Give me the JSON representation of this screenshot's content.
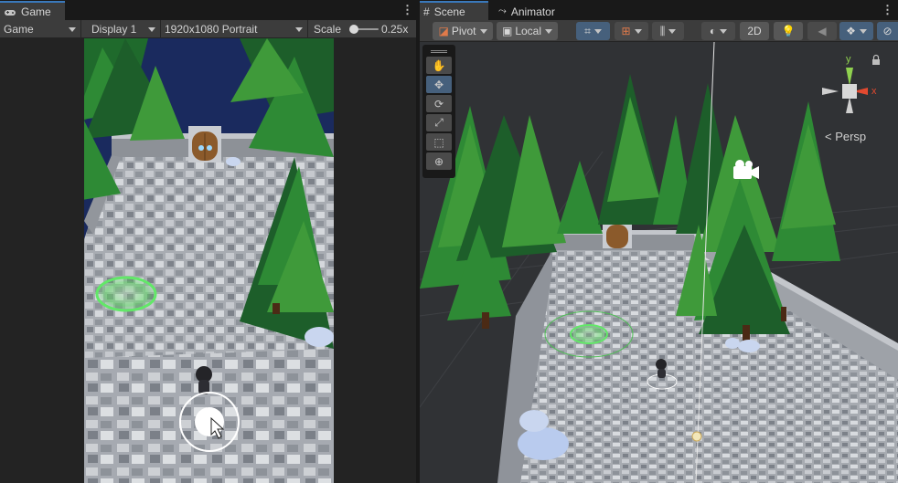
{
  "colors": {
    "accent_blue": "#3a79bb",
    "panel_bg": "#282828",
    "toolbar_bg": "#3c3c3c",
    "tab_bg": "#191919",
    "gizmo_y": "#8fd14f",
    "gizmo_x": "#e2492f",
    "tree_dark": "#1d5e2a",
    "tree_light": "#3f9a3a",
    "stone_floor": "#a9adb3",
    "night_sky": "#1a2a5e"
  },
  "game": {
    "tab_label": "Game",
    "tab_icon": "gamepad-icon",
    "mode_dropdown": "Game",
    "display_dropdown": "Display 1",
    "resolution_dropdown": "1920x1080 Portrait",
    "scale_label": "Scale",
    "scale_value": "0.25x",
    "scale_fraction": 0.25
  },
  "scene": {
    "tab_label": "Scene",
    "tab_icon": "grid-icon",
    "animator_tab_label": "Animator",
    "animator_icon": "animator-icon",
    "pivot_label": "Pivot",
    "local_label": "Local",
    "mode_2d_label": "2D",
    "persp_label": "< Persp",
    "gizmo_y_label": "y",
    "gizmo_x_label": "x",
    "tools": [
      {
        "name": "hand-tool-icon",
        "glyph": "✋"
      },
      {
        "name": "move-tool-icon",
        "glyph": "✥"
      },
      {
        "name": "rotate-tool-icon",
        "glyph": "⟳"
      },
      {
        "name": "scale-tool-icon",
        "glyph": "⤢"
      },
      {
        "name": "rect-tool-icon",
        "glyph": "⬚"
      },
      {
        "name": "transform-tool-icon",
        "glyph": "⊕"
      }
    ]
  }
}
